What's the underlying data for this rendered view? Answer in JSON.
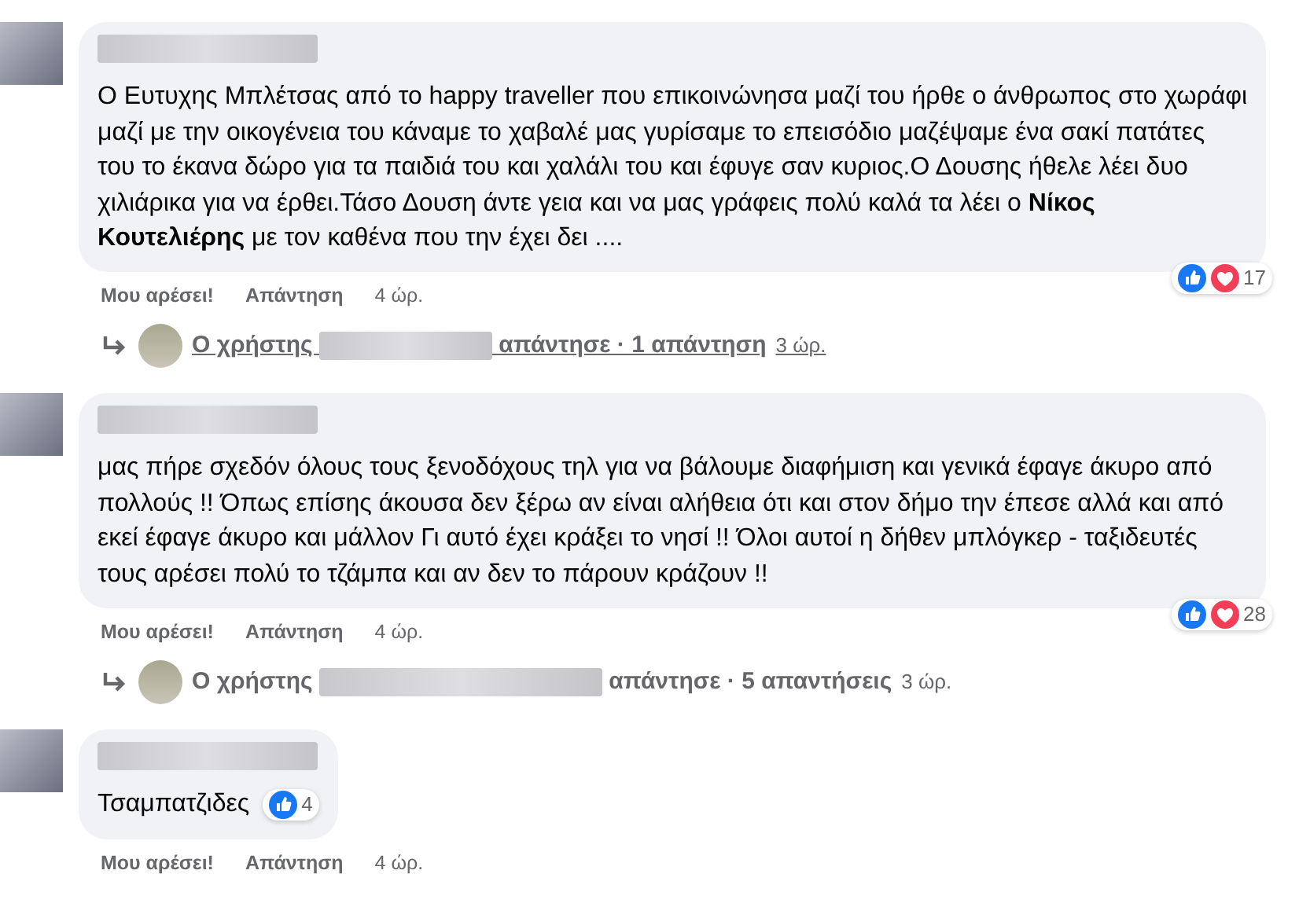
{
  "comments": [
    {
      "text": "Ο Ευτυχης Μπλέτσας από το happy traveller που επικοινώνησα μαζί του ήρθε ο άνθρωπος στο χωράφι μαζί με την οικογένεια του κάναμε το χαβαλέ μας γυρίσαμε το επεισόδιο μαζέψαμε ένα σακί πατάτες του το έκανα δώρο για τα παιδιά του και χαλάλι του και έφυγε σαν κυριος.Ο Δουσης ήθελε λέει δυο χιλιάρικα για να έρθει.Τάσο Δουση άντε γεια και να μας γράφεις πολύ καλά τα λέει ο **Νίκος Κουτελιέρης** με τον καθένα που την έχει δει ....",
      "reactions": [
        {
          "kind": "like"
        },
        {
          "kind": "love"
        }
      ],
      "reaction_count": "17",
      "like": "Μου αρέσει!",
      "reply": "Απάντηση",
      "time": "4 ώρ.",
      "replies": {
        "prefix": "Ο χρήστης",
        "verb": "απάντησε",
        "dot": "·",
        "count": "1 απάντηση",
        "time": "3 ώρ.",
        "underlined": true
      }
    },
    {
      "text": "μας πήρε σχεδόν όλους τους ξενοδόχους τηλ για να βάλουμε διαφήμιση και γενικά έφαγε άκυρο από πολλούς !! Όπως επίσης άκουσα δεν ξέρω αν είναι αλήθεια ότι και στον δήμο την έπεσε αλλά και από εκεί έφαγε άκυρο και μάλλον Γι αυτό έχει κράξει το νησί !! Όλοι αυτοί η δήθεν μπλόγκερ - ταξιδευτές τους αρέσει πολύ το τζάμπα και αν δεν το πάρουν κράζουν !!",
      "reactions": [
        {
          "kind": "like"
        },
        {
          "kind": "love"
        }
      ],
      "reaction_count": "28",
      "like": "Μου αρέσει!",
      "reply": "Απάντηση",
      "time": "4 ώρ.",
      "replies": {
        "prefix": "Ο χρήστης",
        "verb": "απάντησε",
        "dot": "·",
        "count": "5 απαντήσεις",
        "time": "3 ώρ.",
        "underlined": false
      }
    },
    {
      "text": "Τσαμπατζιδες",
      "reactions": [
        {
          "kind": "like"
        }
      ],
      "reaction_count": "4",
      "like": "Μου αρέσει!",
      "reply": "Απάντηση",
      "time": "4 ώρ."
    }
  ]
}
